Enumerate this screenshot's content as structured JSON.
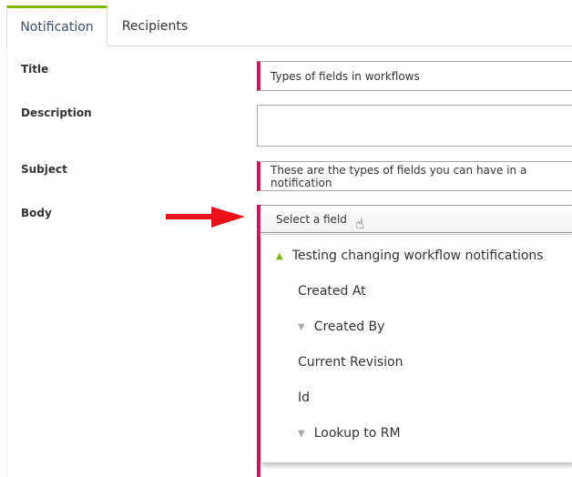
{
  "tabs": [
    {
      "label": "Notification",
      "active": true
    },
    {
      "label": "Recipients",
      "active": false
    }
  ],
  "form": {
    "title_label": "Title",
    "title_value": "Types of fields in workflows",
    "description_label": "Description",
    "description_value": "",
    "subject_label": "Subject",
    "subject_value": "These are the types of fields you can have in a notification",
    "body_label": "Body",
    "body_select_placeholder": "Select a field"
  },
  "dropdown": {
    "group": "Testing changing workflow notifications",
    "items": [
      {
        "label": "Created At",
        "expandable": false
      },
      {
        "label": "Created By",
        "expandable": true
      },
      {
        "label": "Current Revision",
        "expandable": false
      },
      {
        "label": "Id",
        "expandable": false
      },
      {
        "label": "Lookup to RM",
        "expandable": true
      }
    ]
  },
  "colors": {
    "accent": "#7cb800",
    "required": "#d4145a",
    "annotation_arrow": "#e8101a"
  }
}
